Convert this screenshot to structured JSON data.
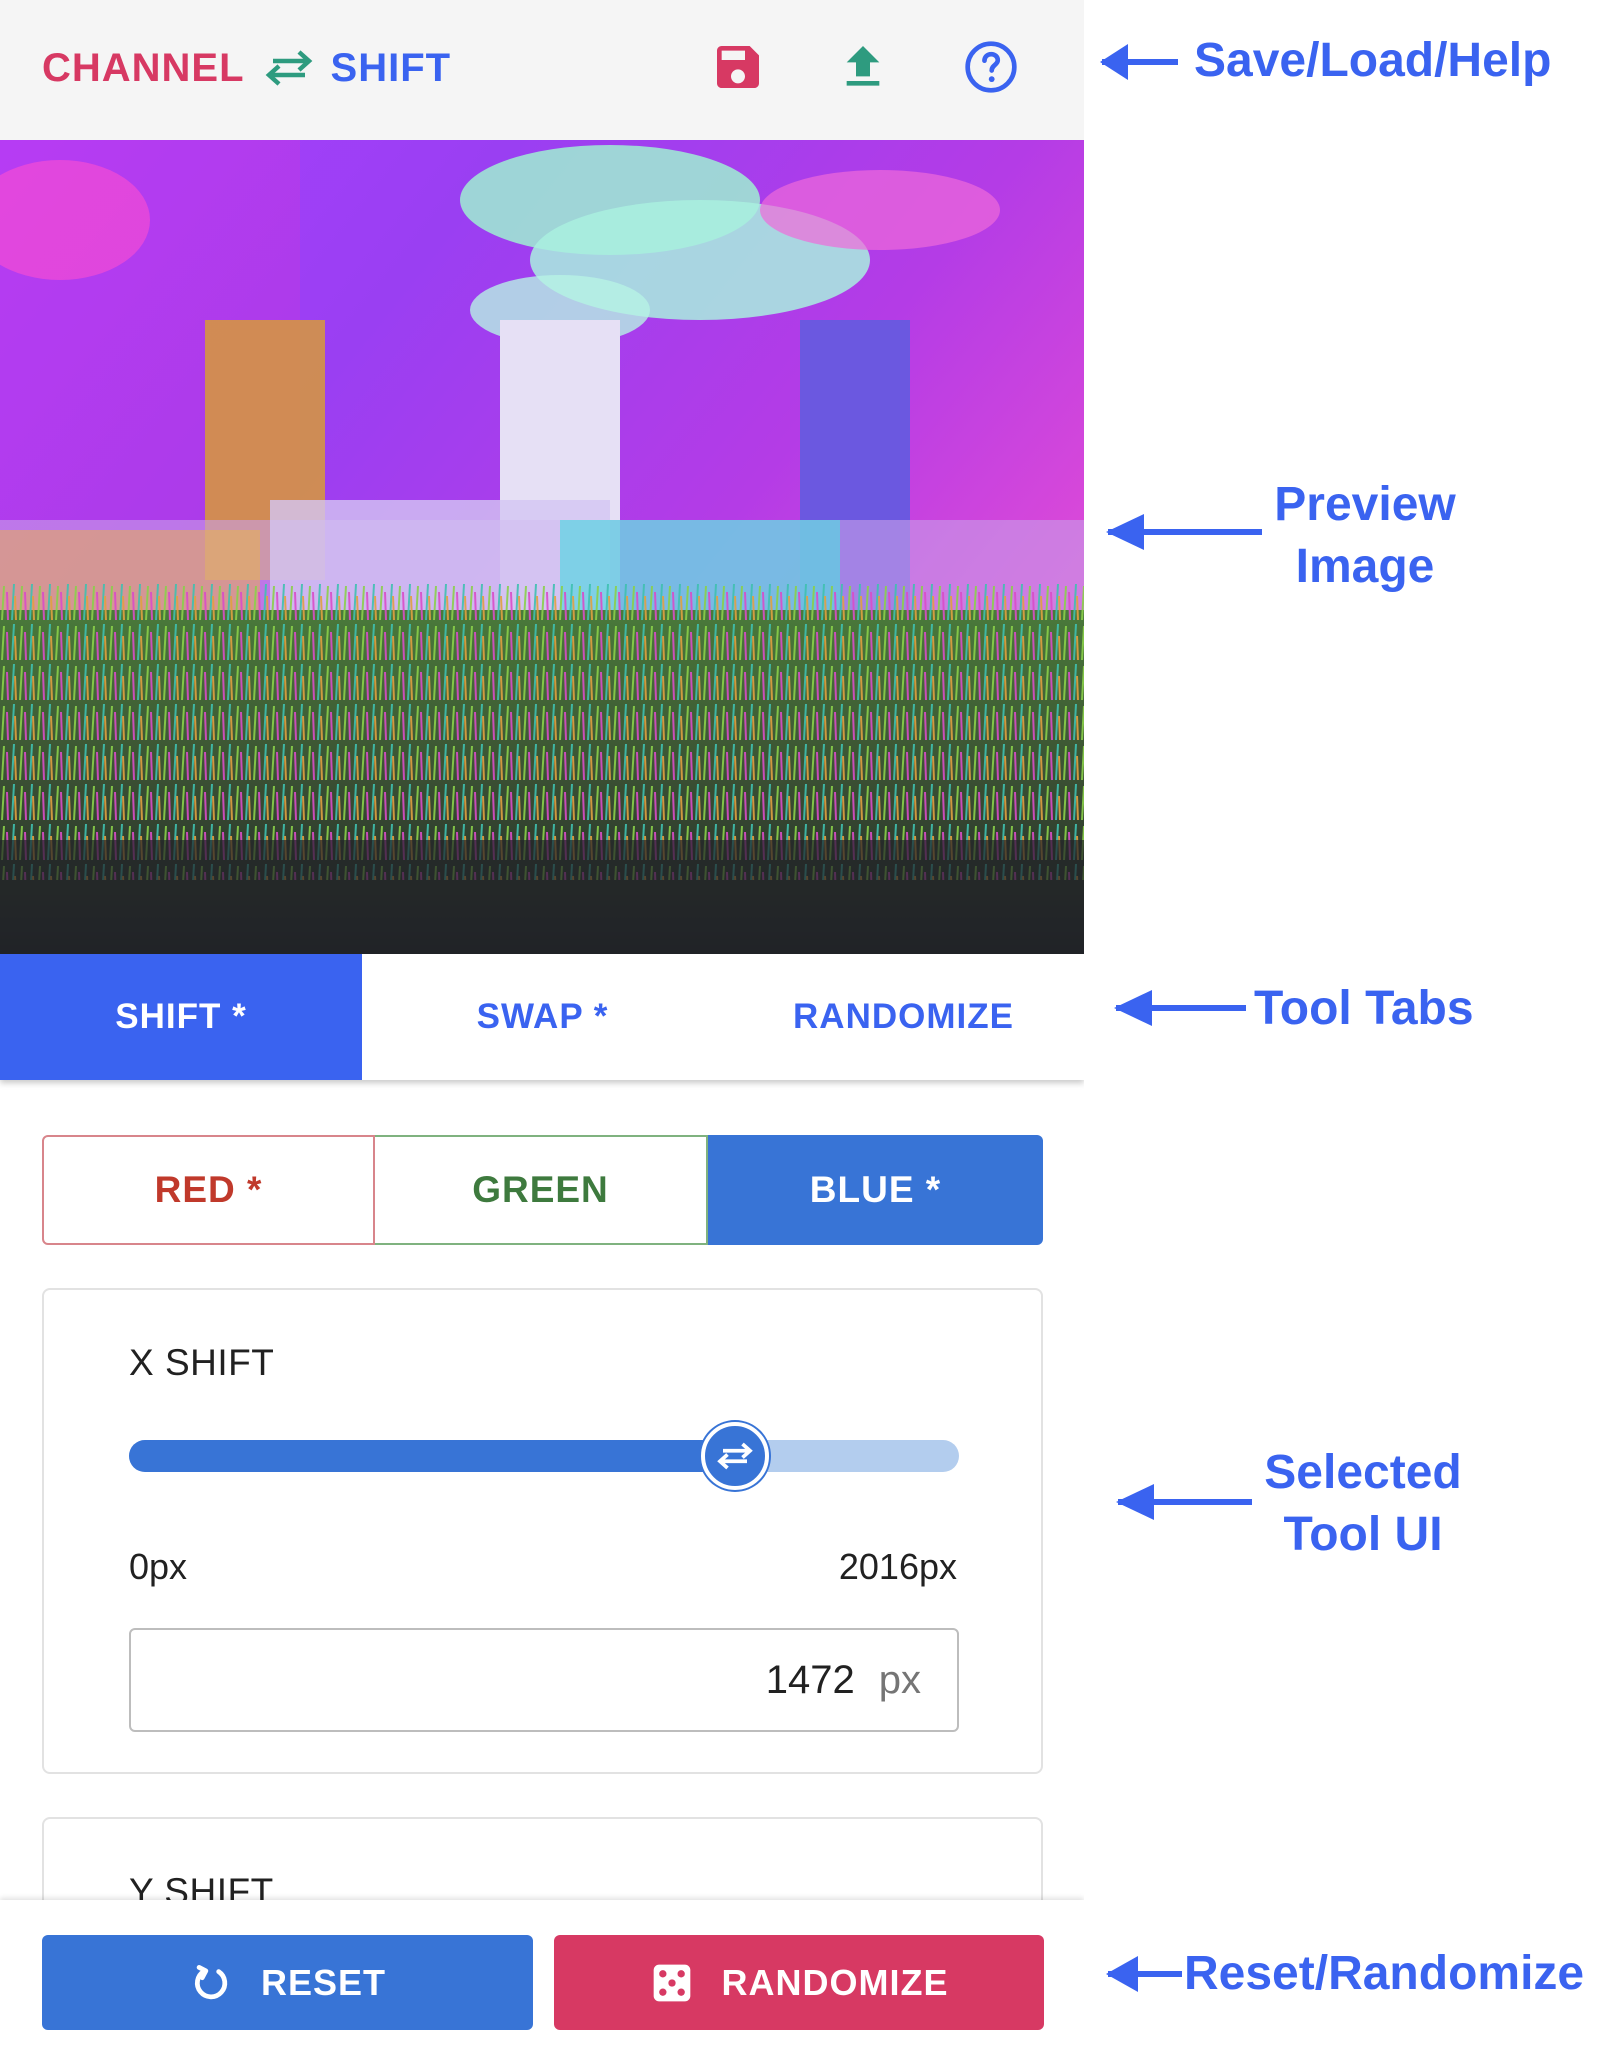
{
  "header": {
    "brand_word1": "CHANNEL",
    "brand_word2": "SHIFT",
    "save_icon": "floppy-disk-icon",
    "load_icon": "upload-icon",
    "help_icon": "help-circle-icon"
  },
  "tabs": [
    {
      "label": "SHIFT *",
      "active": true
    },
    {
      "label": "SWAP *",
      "active": false
    },
    {
      "label": "RANDOMIZE",
      "active": false
    }
  ],
  "channels": [
    {
      "label": "RED *",
      "active": false
    },
    {
      "label": "GREEN",
      "active": false
    },
    {
      "label": "BLUE *",
      "active": true
    }
  ],
  "x_shift": {
    "title": "X SHIFT",
    "min_label": "0px",
    "max_label": "2016px",
    "min": 0,
    "max": 2016,
    "value": "1472",
    "unit": "px"
  },
  "y_shift": {
    "title": "Y SHIFT"
  },
  "bottom": {
    "reset_label": "RESET",
    "randomize_label": "RANDOMIZE"
  },
  "annotations": {
    "save_load_help": "Save/Load/Help",
    "preview_line1": "Preview",
    "preview_line2": "Image",
    "tool_tabs": "Tool Tabs",
    "selected_line1": "Selected",
    "selected_line2": "Tool UI",
    "reset_randomize": "Reset/Randomize"
  },
  "colors": {
    "primary": "#3874d6",
    "accent_blue": "#3a63f0",
    "brand_red": "#d73963",
    "teal_icon": "#2e9b7f"
  }
}
